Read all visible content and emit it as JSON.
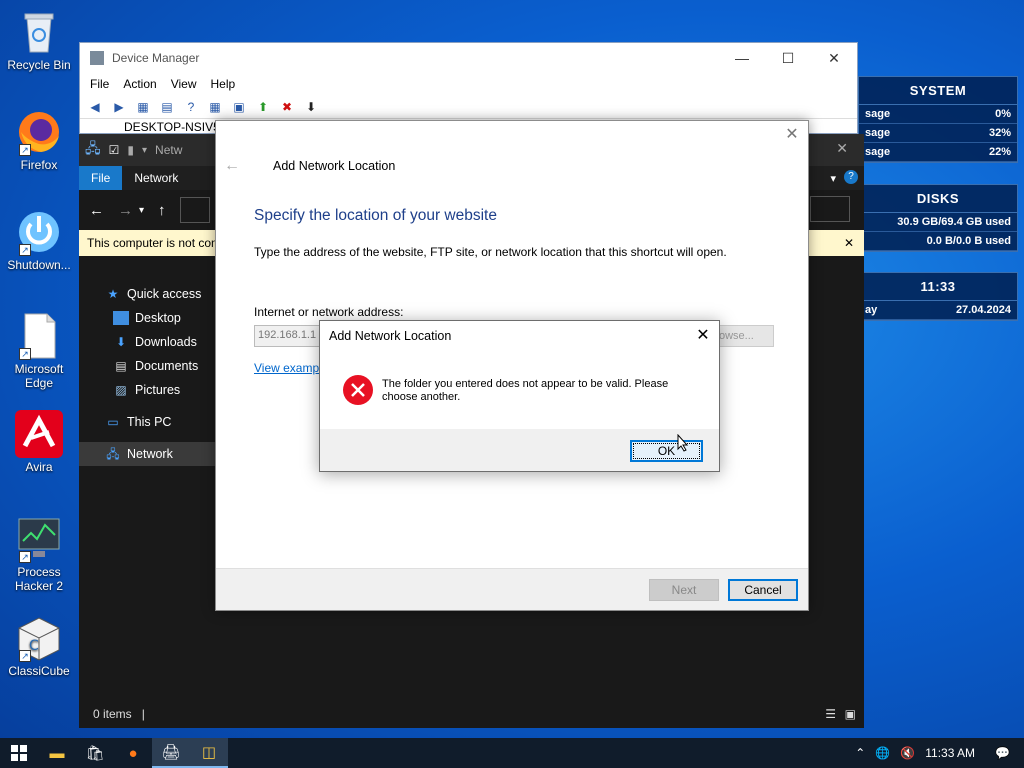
{
  "desktop": {
    "icons": [
      {
        "label": "Recycle Bin"
      },
      {
        "label": "Firefox"
      },
      {
        "label": "Shutdown..."
      },
      {
        "label": "Microsoft Edge"
      },
      {
        "label": "Avira"
      },
      {
        "label": "Process Hacker 2"
      },
      {
        "label": "ClassiCube"
      }
    ]
  },
  "widgets": {
    "system": {
      "title": "SYSTEM",
      "rows": [
        [
          "sage",
          "0%"
        ],
        [
          "sage",
          "32%"
        ],
        [
          "sage",
          "22%"
        ]
      ]
    },
    "disks": {
      "title": "DISKS",
      "rows": [
        [
          "",
          "30.9 GB/69.4 GB used"
        ],
        [
          "",
          "0.0 B/0.0 B used"
        ]
      ]
    },
    "clock": {
      "time": "11:33",
      "day_fragment": "ay",
      "date": "27.04.2024"
    }
  },
  "device_manager": {
    "title": "Device Manager",
    "menu": [
      "File",
      "Action",
      "View",
      "Help"
    ],
    "tree_root_partial": "DESKTOP-NSIV5A"
  },
  "explorer": {
    "title_partial": "Netw",
    "ribbon_tabs": [
      "File",
      "Network"
    ],
    "banner_text": "This computer is not con",
    "sidebar": [
      "Quick access",
      "Desktop",
      "Downloads",
      "Documents",
      "Pictures",
      "This PC",
      "Network"
    ],
    "status": "0 items"
  },
  "wizard": {
    "title": "Add Network Location",
    "heading": "Specify the location of your website",
    "description": "Type the address of the website, FTP site, or network location that this shortcut will open.",
    "address_label": "Internet or network address:",
    "address_value": "192.168.1.1",
    "browse_label": "owse...",
    "examples_link": "View examp",
    "next_label": "Next",
    "cancel_label": "Cancel"
  },
  "error_dialog": {
    "title": "Add Network Location",
    "message": "The folder you entered does not appear to be valid.  Please choose another.",
    "ok_label": "OK"
  },
  "taskbar": {
    "time": "11:33 AM"
  },
  "colors": {
    "accent": "#0078d7",
    "error_red": "#e81123",
    "wizard_heading": "#1e3f8a"
  }
}
